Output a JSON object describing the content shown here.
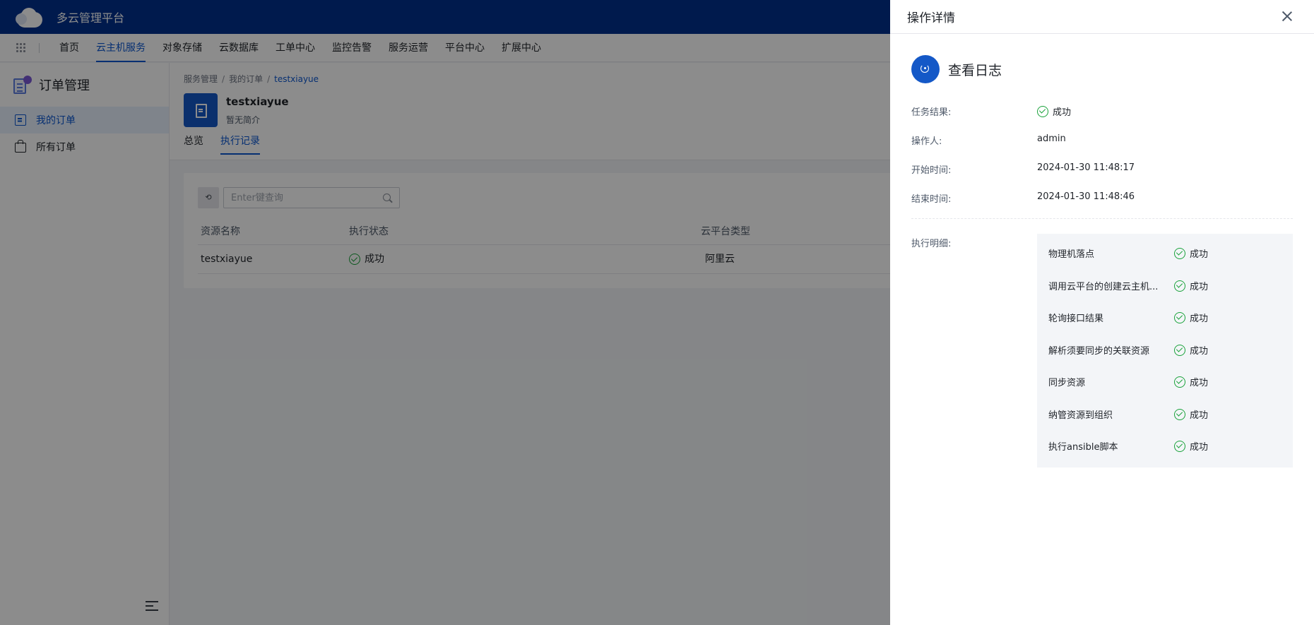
{
  "header": {
    "app_title": "多云管理平台"
  },
  "nav": {
    "items": [
      "首页",
      "云主机服务",
      "对象存储",
      "云数据库",
      "工单中心",
      "监控告警",
      "服务运营",
      "平台中心",
      "扩展中心"
    ],
    "active_index": 1
  },
  "sidebar": {
    "title": "订单管理",
    "items": [
      {
        "label": "我的订单",
        "icon": "document-icon",
        "active": true
      },
      {
        "label": "所有订单",
        "icon": "bag-icon",
        "active": false
      }
    ]
  },
  "page": {
    "breadcrumb": [
      "服务管理",
      "我的订单",
      "testxiayue"
    ],
    "resource_name": "testxiayue",
    "resource_desc": "暂无简介",
    "tabs": [
      "总览",
      "执行记录"
    ],
    "active_tab": 1
  },
  "search": {
    "placeholder": "Enter键查询",
    "value": ""
  },
  "table": {
    "headers": [
      "资源名称",
      "执行状态",
      "云平台类型"
    ],
    "rows": [
      {
        "name": "testxiayue",
        "status": "成功",
        "platform": "阿里云"
      }
    ]
  },
  "drawer": {
    "title": "操作详情",
    "log_title": "查看日志",
    "fields": [
      {
        "label": "任务结果:",
        "value": "成功",
        "status_icon": true
      },
      {
        "label": "操作人:",
        "value": "admin",
        "status_icon": false
      },
      {
        "label": "开始时间:",
        "value": "2024-01-30 11:48:17",
        "status_icon": false
      },
      {
        "label": "结束时间:",
        "value": "2024-01-30 11:48:46",
        "status_icon": false
      }
    ],
    "detail_label": "执行明细:",
    "steps": [
      {
        "name": "物理机落点",
        "status": "成功"
      },
      {
        "name": "调用云平台的创建云主机...",
        "status": "成功"
      },
      {
        "name": "轮询接口结果",
        "status": "成功"
      },
      {
        "name": "解析须要同步的关联资源",
        "status": "成功"
      },
      {
        "name": "同步资源",
        "status": "成功"
      },
      {
        "name": "纳管资源到组织",
        "status": "成功"
      },
      {
        "name": "执行ansible脚本",
        "status": "成功"
      }
    ]
  },
  "colors": {
    "primary": "#0b57d0",
    "header_bg": "#00318c",
    "success": "#19a23a"
  }
}
